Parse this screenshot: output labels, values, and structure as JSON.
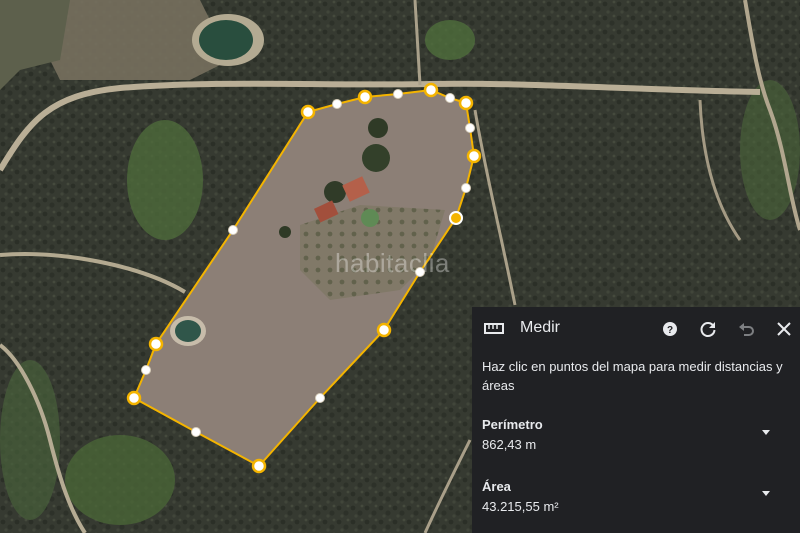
{
  "map": {
    "watermark": "habitaclia",
    "accent_color": "#f4b400",
    "measure_polygon": "measured-area-outline"
  },
  "panel": {
    "icon": "ruler-icon",
    "title": "Medir",
    "help_icon": "help-icon",
    "reset_icon": "refresh-icon",
    "undo_icon": "undo-icon",
    "close_icon": "close-icon",
    "description": "Haz clic en puntos del mapa para medir distancias y áreas",
    "perimeter_label": "Perímetro",
    "perimeter_value": "862,43 m",
    "area_label": "Área",
    "area_value": "43.215,55 m²",
    "expand_icon": "chevron-down-icon",
    "background": "#202124"
  }
}
